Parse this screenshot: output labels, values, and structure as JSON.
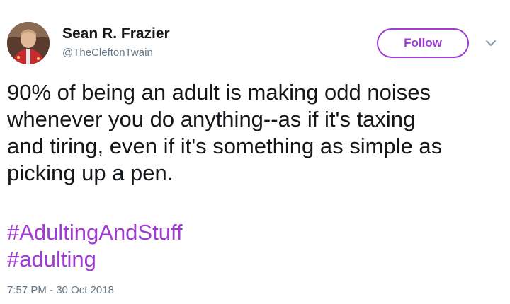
{
  "author": {
    "name": "Sean R. Frazier",
    "handle": "@TheCleftonTwain"
  },
  "follow_button": {
    "label": "Follow"
  },
  "menu": {
    "icon": "chevron-down-icon"
  },
  "tweet": {
    "lines": [
      "90% of being an adult is making odd noises",
      "whenever you do anything--as if it's taxing",
      "and tiring, even if it's something as simple as",
      "picking up a pen."
    ],
    "hashtags": [
      "#AdultingAndStuff",
      "#adulting"
    ],
    "timestamp": "7:57 PM - 30 Oct 2018"
  },
  "colors": {
    "accent": "#a03ad6",
    "text": "#14171a",
    "secondary": "#657786"
  }
}
